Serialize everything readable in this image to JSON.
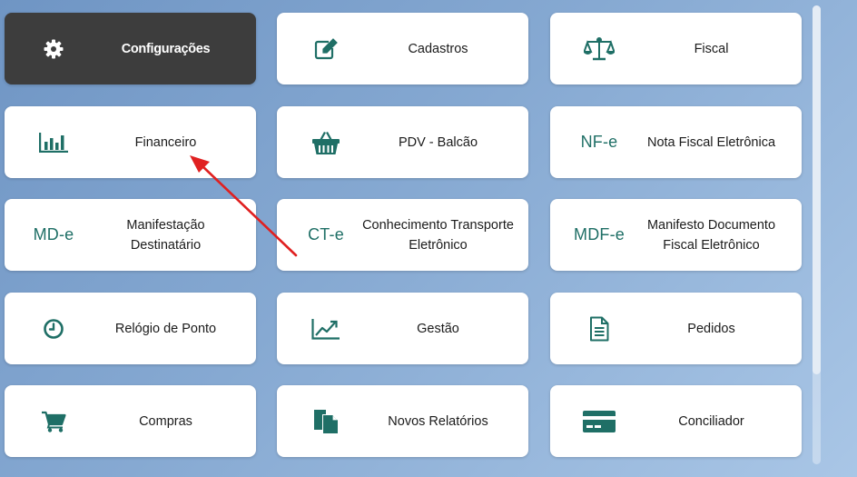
{
  "tiles": [
    {
      "label": "Configurações",
      "icon": "gear-icon"
    },
    {
      "label": "Cadastros",
      "icon": "edit-icon"
    },
    {
      "label": "Fiscal",
      "icon": "balance-scale-icon"
    },
    {
      "label": "Financeiro",
      "icon": "bar-chart-icon"
    },
    {
      "label": "PDV - Balcão",
      "icon": "shopping-basket-icon"
    },
    {
      "abbr": "NF-e",
      "label": "Nota Fiscal Eletrônica"
    },
    {
      "abbr": "MD-e",
      "label_line1": "Manifestação",
      "label_line2": "Destinatário"
    },
    {
      "abbr": "CT-e",
      "label_line1": "Conhecimento Transporte",
      "label_line2": "Eletrônico"
    },
    {
      "abbr": "MDF-e",
      "label_line1": "Manifesto Documento",
      "label_line2": "Fiscal Eletrônico"
    },
    {
      "label": "Relógio de Ponto",
      "icon": "clock-icon"
    },
    {
      "label": "Gestão",
      "icon": "line-chart-icon"
    },
    {
      "label": "Pedidos",
      "icon": "document-icon"
    },
    {
      "label": "Compras",
      "icon": "shopping-cart-icon"
    },
    {
      "label": "Novos Relatórios",
      "icon": "copy-document-icon"
    },
    {
      "label": "Conciliador",
      "icon": "credit-card-icon"
    }
  ],
  "colors": {
    "accent": "#1f6f66",
    "active_tile": "#3d3d3d",
    "annotation_arrow": "#e02020"
  }
}
